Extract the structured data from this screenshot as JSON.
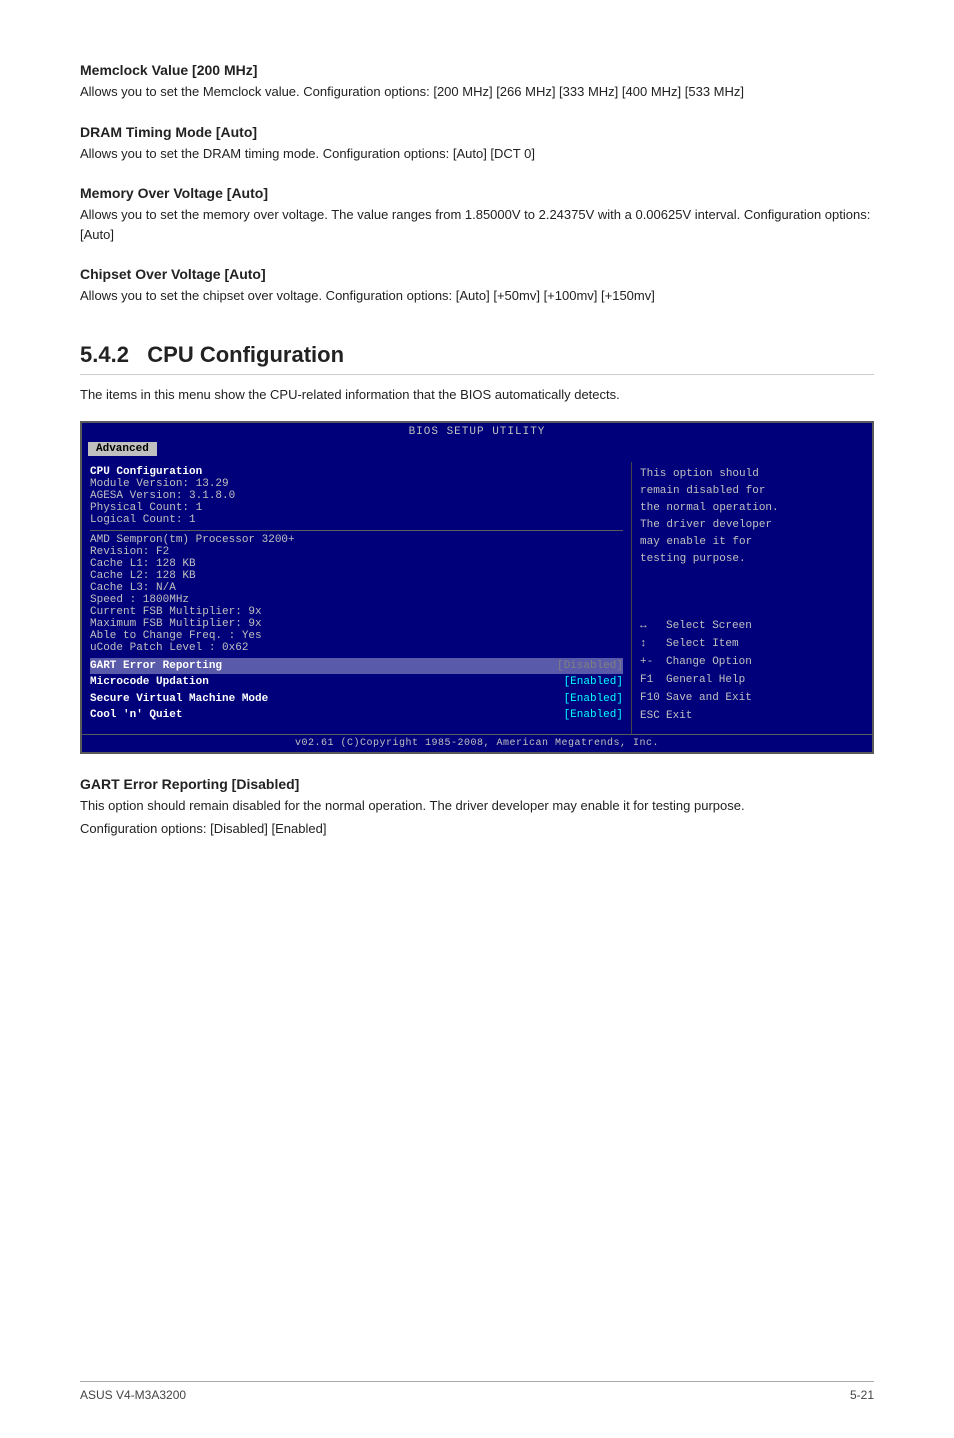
{
  "sections": [
    {
      "id": "memclock",
      "heading": "Memclock Value [200 MHz]",
      "text": "Allows you to set the Memclock value. Configuration options: [200 MHz] [266 MHz] [333 MHz] [400 MHz] [533 MHz]"
    },
    {
      "id": "dram",
      "heading": "DRAM Timing Mode [Auto]",
      "text": "Allows you to set the DRAM timing mode. Configuration options: [Auto] [DCT 0]"
    },
    {
      "id": "memvolt",
      "heading": "Memory Over Voltage [Auto]",
      "text": "Allows you to set the memory over voltage. The value ranges from 1.85000V to 2.24375V with a 0.00625V interval. Configuration options: [Auto]"
    },
    {
      "id": "chipset",
      "heading": "Chipset Over Voltage [Auto]",
      "text": "Allows you to set the chipset over voltage. Configuration options: [Auto] [+50mv] [+100mv] [+150mv]"
    }
  ],
  "chapter": {
    "number": "5.4.2",
    "title": "CPU Configuration",
    "intro": "The items in this menu show the CPU-related information that the BIOS automatically detects."
  },
  "bios": {
    "title": "BIOS SETUP UTILITY",
    "tab": "Advanced",
    "left": {
      "heading": "CPU Configuration",
      "info_lines": [
        "Module Version: 13.29",
        "AGESA Version: 3.1.8.0",
        "Physical Count: 1",
        "Logical Count: 1"
      ],
      "cpu_lines": [
        "AMD Sempron(tm) Processor 3200+",
        "Revision: F2",
        "Cache L1: 128 KB",
        "Cache L2: 128 KB",
        "Cache L3: N/A",
        "Speed   : 1800MHz",
        "Current FSB Multiplier: 9x",
        "Maximum FSB Multiplier: 9x",
        "Able to Change Freq. : Yes",
        "uCode Patch Level    : 0x62"
      ],
      "settings": [
        {
          "label": "GART Error Reporting",
          "value": "[Disabled]",
          "highlight": true
        },
        {
          "label": "Microcode Updation",
          "value": "[Enabled]",
          "highlight": false
        },
        {
          "label": "Secure Virtual Machine Mode",
          "value": "[Enabled]",
          "highlight": false
        },
        {
          "label": "Cool 'n' Quiet",
          "value": "[Enabled]",
          "highlight": false
        }
      ]
    },
    "right": {
      "description": [
        "This option should",
        "remain disabled for",
        "the normal operation.",
        "The driver developer",
        "may enable it for",
        "testing purpose."
      ],
      "keys": [
        {
          "symbol": "↔",
          "description": "Select Screen"
        },
        {
          "symbol": "↕",
          "description": "Select Item"
        },
        {
          "symbol": "+-",
          "description": "Change Option"
        },
        {
          "symbol": "F1",
          "description": "General Help"
        },
        {
          "symbol": "F10",
          "description": "Save and Exit"
        },
        {
          "symbol": "ESC",
          "description": "Exit"
        }
      ]
    },
    "footer": "v02.61 (C)Copyright 1985-2008, American Megatrends, Inc."
  },
  "gart_section": {
    "heading": "GART Error Reporting [Disabled]",
    "text1": "This option should remain disabled for the normal operation. The driver developer may enable it for testing purpose.",
    "text2": "Configuration options: [Disabled] [Enabled]"
  },
  "page_footer": {
    "left": "ASUS V4-M3A3200",
    "right": "5-21"
  }
}
